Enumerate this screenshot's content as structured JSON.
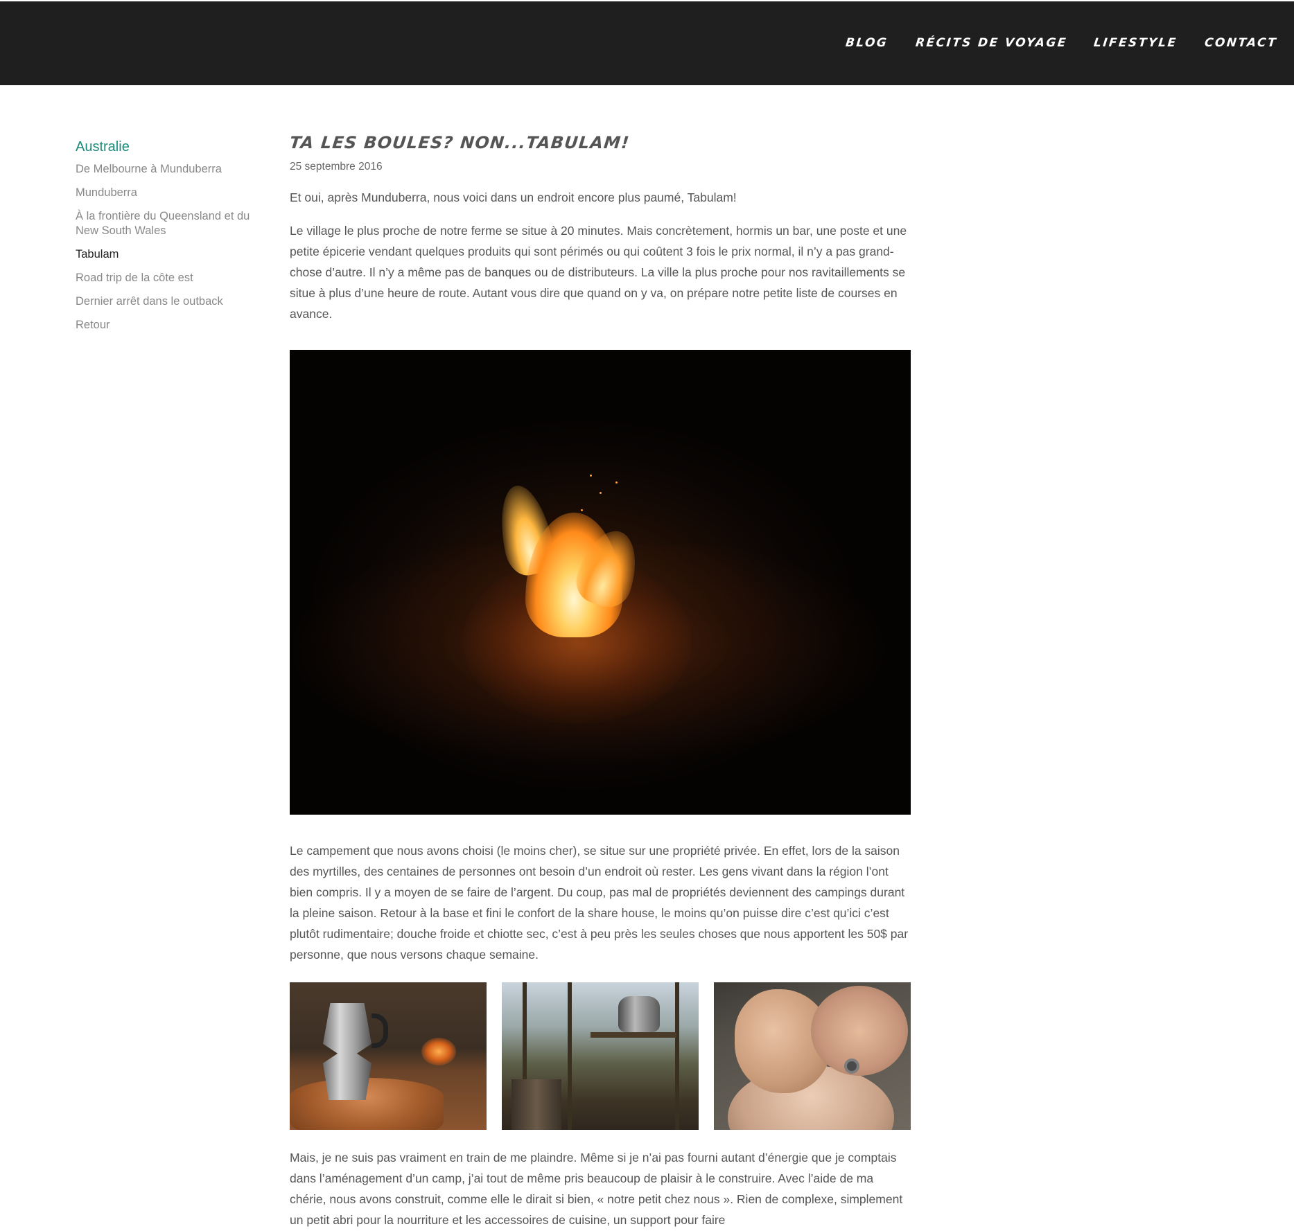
{
  "nav": {
    "items": [
      "Blog",
      "Récits de voyage",
      "Lifestyle",
      "Contact"
    ]
  },
  "sidebar": {
    "category": "Australie",
    "items": [
      "De Melbourne à Munduberra",
      "Munduberra",
      "À la frontière du Queensland et du New South Wales",
      "Tabulam",
      "Road trip de la côte est",
      "Dernier arrêt dans le outback",
      "Retour"
    ],
    "active": "Tabulam"
  },
  "article": {
    "title": "Ta les boules? Non...Tabulam!",
    "date": "25 septembre 2016",
    "p1": "Et oui, après Munduberra, nous voici dans un endroit encore plus paumé, Tabulam!",
    "p2": "Le village le plus proche de notre ferme se situe à 20 minutes. Mais concrètement, hormis un bar, une poste et une petite épicerie vendant quelques produits qui sont périmés ou qui coûtent 3 fois le prix normal, il n’y a pas grand-chose d’autre. Il n’y a même pas de banques ou de distributeurs. La ville la plus proche pour nos ravitaillements se situe à plus d’une heure de route. Autant vous dire que quand on y va, on prépare notre petite liste de courses en avance.",
    "p3": "Le campement que nous avons choisi (le moins cher), se situe sur une propriété privée. En effet, lors de la saison des myrtilles, des centaines de personnes ont besoin d’un endroit où rester. Les gens vivant dans la région l’ont bien compris. Il y a moyen de se faire de l’argent. Du coup, pas mal de propriétés deviennent des campings durant la pleine saison. Retour à la base et fini le confort de la share house, le moins qu’on puisse dire c’est qu’ici c’est plutôt rudimentaire; douche froide et chiotte sec, c’est à peu près les seules choses que nous apportent les 50$ par personne, que nous versons chaque semaine.",
    "p4": "Mais, je ne suis pas vraiment en train de me plaindre. Même si je n’ai pas fourni autant d’énergie que je comptais dans l’aménagement d’un camp, j’ai tout de même pris beaucoup de plaisir à le construire. Avec l’aide de ma chérie, nous avons construit, comme elle le dirait si bien, « notre petit chez nous ». Rien de complexe, simplement un petit abri pour la nourriture et les accessoires de cuisine, un support pour faire"
  },
  "colors": {
    "topbar": "#1f1f1f",
    "category_link": "#1a8a7a",
    "body_text": "#555555"
  }
}
